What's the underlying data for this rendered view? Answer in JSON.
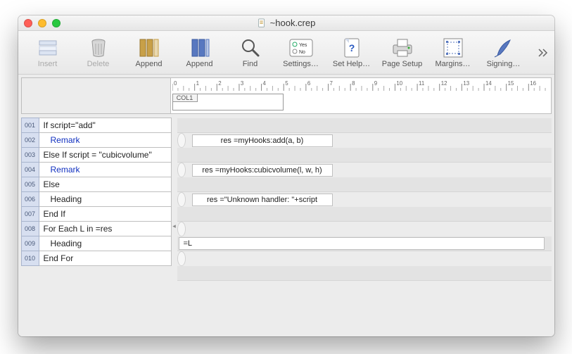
{
  "window": {
    "title": "~hook.crep"
  },
  "toolbar": {
    "insert": "Insert",
    "delete": "Delete",
    "append1": "Append",
    "append2": "Append",
    "find": "Find",
    "settings": "Settings…",
    "sethelp": "Set Help…",
    "pagesetup": "Page Setup",
    "margins": "Margins…",
    "signing": "Signing…"
  },
  "ruler": {
    "col_label": "COL1"
  },
  "lines": [
    {
      "n": "001",
      "text": "If script=\"add\"",
      "cls": ""
    },
    {
      "n": "002",
      "text": "Remark",
      "cls": "kw-blue indent1"
    },
    {
      "n": "003",
      "text": "Else If script = \"cubicvolume\"",
      "cls": ""
    },
    {
      "n": "004",
      "text": "Remark",
      "cls": "kw-blue indent1"
    },
    {
      "n": "005",
      "text": "Else",
      "cls": ""
    },
    {
      "n": "006",
      "text": "Heading",
      "cls": "indent1"
    },
    {
      "n": "007",
      "text": "End If",
      "cls": ""
    },
    {
      "n": "008",
      "text": "For Each L in =res",
      "cls": ""
    },
    {
      "n": "009",
      "text": "Heading",
      "cls": "indent1"
    },
    {
      "n": "010",
      "text": "End For",
      "cls": ""
    }
  ],
  "cells": {
    "r2": "res =myHooks:add(a, b)",
    "r4": "res =myHooks:cubicvolume(l, w, h)",
    "r6": "res =\"Unknown handler: \"+script",
    "r9": "=L"
  }
}
